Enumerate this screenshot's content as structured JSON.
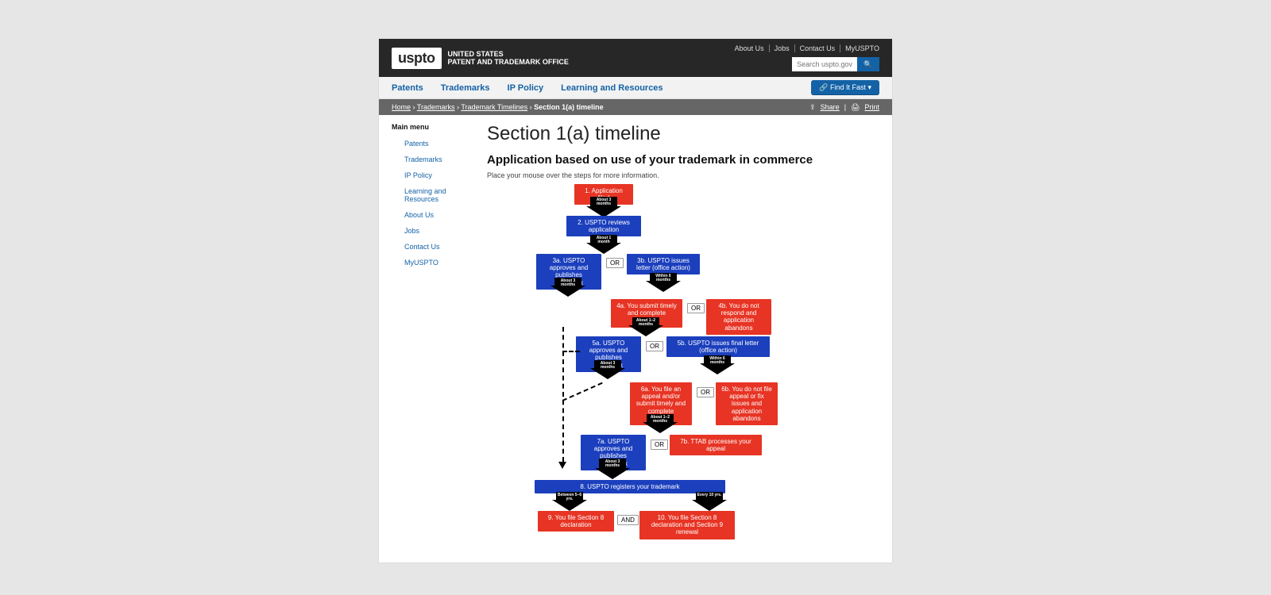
{
  "header": {
    "logo_box": "uspto",
    "logo_line1": "UNITED STATES",
    "logo_line2": "PATENT AND TRADEMARK OFFICE",
    "links": [
      "About Us",
      "Jobs",
      "Contact Us",
      "MyUSPTO"
    ],
    "search_placeholder": "Search uspto.gov",
    "find_fast": "Find It Fast"
  },
  "nav": [
    "Patents",
    "Trademarks",
    "IP Policy",
    "Learning and Resources"
  ],
  "breadcrumb": {
    "items": [
      "Home",
      "Trademarks",
      "Trademark Timelines"
    ],
    "current": "Section 1(a) timeline",
    "share": "Share",
    "print": "Print"
  },
  "sidebar": {
    "title": "Main menu",
    "items": [
      "Patents",
      "Trademarks",
      "IP Policy",
      "Learning and Resources",
      "About Us",
      "Jobs",
      "Contact Us",
      "MyUSPTO"
    ]
  },
  "page": {
    "title": "Section 1(a) timeline",
    "subtitle": "Application based on use of your trademark in commerce",
    "hint": "Place your mouse over the steps for more information."
  },
  "flow": {
    "s1": "1. Application filed",
    "s2": "2. USPTO reviews application",
    "s3a": "3a. USPTO approves and publishes trademark",
    "s3b": "3b. USPTO issues letter (office action)",
    "s4a": "4a. You submit timely and complete response",
    "s4b": "4b. You do not respond and application abandons",
    "s5a": "5a. USPTO approves and publishes trademark",
    "s5b": "5b. USPTO issues final letter (office action)",
    "s6a": "6a. You file an appeal and/or submit timely and complete response",
    "s6b": "6b. You do not file appeal or fix issues and application abandons",
    "s7a": "7a. USPTO approves and publishes trademark",
    "s7b": "7b. TTAB processes your appeal",
    "s8": "8. USPTO registers your trademark",
    "s9": "9. You file Section 8 declaration",
    "s10": "10. You file Section 8 declaration and Section 9 renewal",
    "or": "OR",
    "and": "AND",
    "t_3mo": "About 3 months",
    "t_1mo": "About 1 month",
    "t_6mo": "Within 6 months",
    "t_12mo": "About 1–2 months",
    "t_56": "Between 5–6 yrs.",
    "t_10": "Every 10 yrs."
  }
}
